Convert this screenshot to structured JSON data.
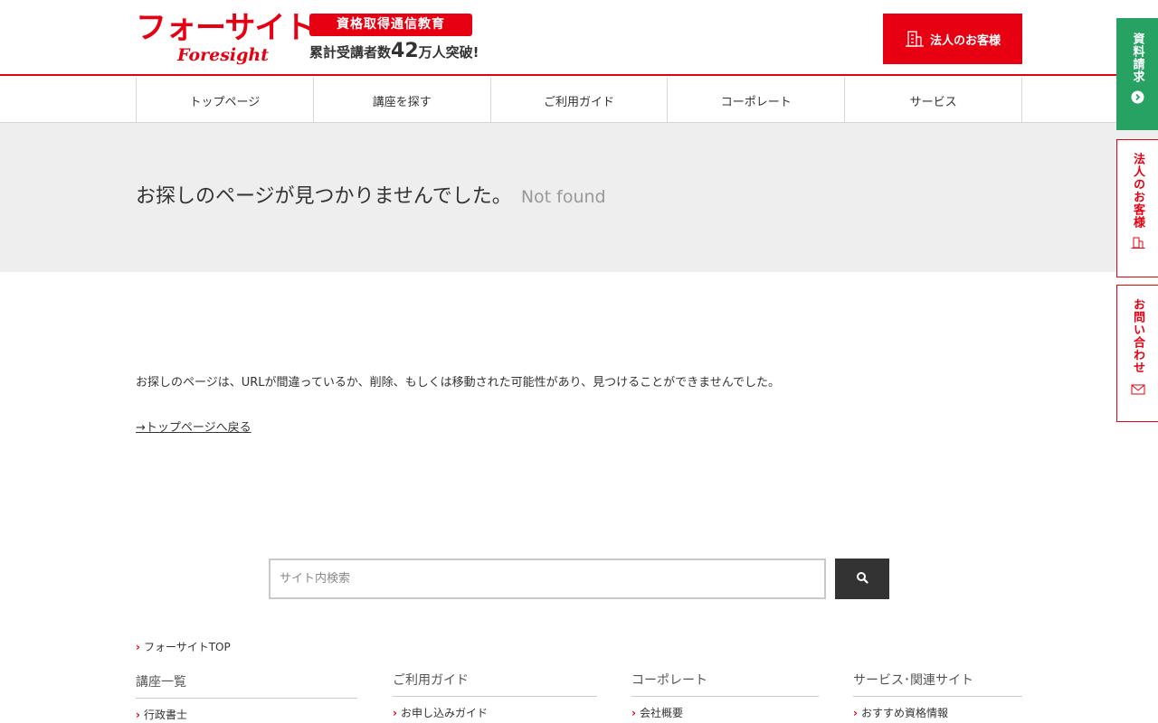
{
  "header": {
    "logo_jp": "フォーサイト",
    "logo_en": "Foresight",
    "tagline": "資格取得通信教育",
    "count_prefix": "累計受講者数",
    "count_number": "42",
    "count_suffix": "万人突破!",
    "corp_button": "法人のお客様"
  },
  "nav": {
    "items": [
      "トップページ",
      "講座を探す",
      "ご利用ガイド",
      "コーポレート",
      "サービス"
    ]
  },
  "page": {
    "title": "お探しのページが見つかりませんでした。",
    "title_en": "Not found",
    "message": "お探しのページは、URLが間違っているか、削除、もしくは移動された可能性があり、見つけることができませんでした。",
    "back_link": "→トップページへ戻る"
  },
  "search": {
    "placeholder": "サイト内検索"
  },
  "footer": {
    "top_link": "フォーサイトTOP",
    "columns": [
      {
        "heading": "講座一覧",
        "item": "行政書士"
      },
      {
        "heading": "ご利用ガイド",
        "item": "お申し込みガイド"
      },
      {
        "heading": "コーポレート",
        "item": "会社概要"
      },
      {
        "heading": "サービス･関連サイト",
        "item": "おすすめ資格情報"
      }
    ]
  },
  "side_tabs": {
    "doc_request": "資料請求",
    "corporate": "法人のお客様",
    "contact": "お問い合わせ"
  },
  "colors": {
    "brand_red": "#e60012",
    "green": "#27a263",
    "title_band": "#eeeeee"
  },
  "icons": [
    "building-icon",
    "search-icon",
    "arrow-right-circle-icon",
    "mail-icon",
    "chevron-right-icon"
  ]
}
